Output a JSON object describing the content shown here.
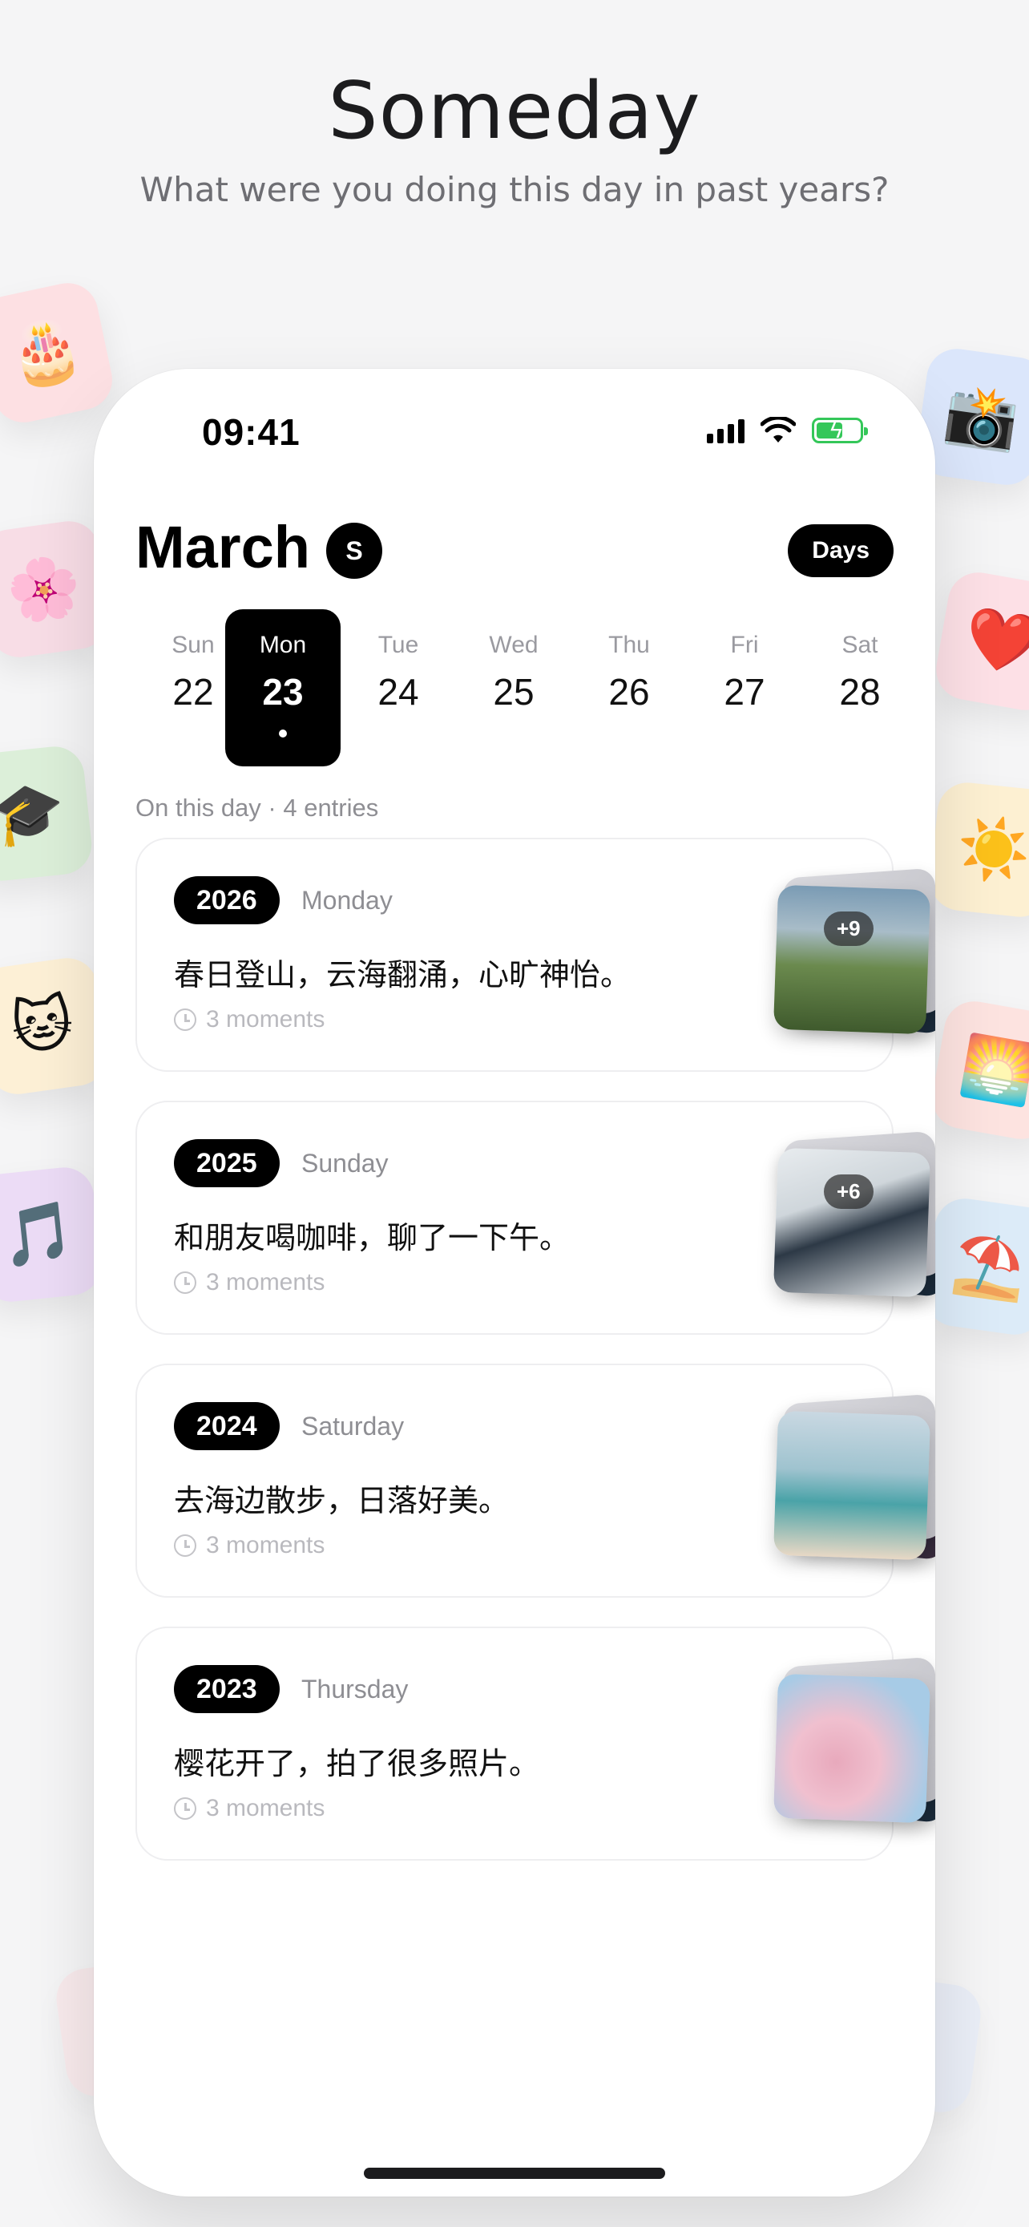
{
  "hero": {
    "title": "Someday",
    "subtitle": "What were you doing this day in past years?"
  },
  "tiles": [
    {
      "icon": "🎂",
      "name": "cake",
      "color": "#fde0e3"
    },
    {
      "icon": "🌸",
      "name": "flower",
      "color": "#f8dde6"
    },
    {
      "icon": "🎓",
      "name": "graduation-cap",
      "color": "#dcefd9"
    },
    {
      "icon": "🐱",
      "name": "cat",
      "color": "#fdf0d6"
    },
    {
      "icon": "🎵",
      "name": "music-note",
      "color": "#ecdcf6"
    },
    {
      "icon": "📸",
      "name": "camera",
      "color": "#dbe6fb"
    },
    {
      "icon": "❤️",
      "name": "heart",
      "color": "#fde0e6"
    },
    {
      "icon": "☀️",
      "name": "sun",
      "color": "#fdf0d2"
    },
    {
      "icon": "🌅",
      "name": "sunset-photo",
      "color": "#fde3e0"
    },
    {
      "icon": "⛱️",
      "name": "beach-umbrella",
      "color": "#dcebf8"
    }
  ],
  "status": {
    "time": "09:41"
  },
  "header": {
    "month": "March",
    "badge": "S",
    "view_button": "Days"
  },
  "week": [
    {
      "name": "Sun",
      "num": "22",
      "active": false
    },
    {
      "name": "Mon",
      "num": "23",
      "active": true
    },
    {
      "name": "Tue",
      "num": "24",
      "active": false
    },
    {
      "name": "Wed",
      "num": "25",
      "active": false
    },
    {
      "name": "Thu",
      "num": "26",
      "active": false
    },
    {
      "name": "Fri",
      "num": "27",
      "active": false
    },
    {
      "name": "Sat",
      "num": "28",
      "active": false
    }
  ],
  "on_this_day": "On this day · 4 entries",
  "entries": [
    {
      "year": "2026",
      "weekday": "Monday",
      "text": "春日登山，云海翻涌，心旷神怡。",
      "moments": "3 moments",
      "more": "+9"
    },
    {
      "year": "2025",
      "weekday": "Sunday",
      "text": "和朋友喝咖啡，聊了一下午。",
      "moments": "3 moments",
      "more": "+6"
    },
    {
      "year": "2024",
      "weekday": "Saturday",
      "text": "去海边散步，日落好美。",
      "moments": "3 moments",
      "more": ""
    },
    {
      "year": "2023",
      "weekday": "Thursday",
      "text": "樱花开了，拍了很多照片。",
      "moments": "3 moments",
      "more": ""
    }
  ]
}
